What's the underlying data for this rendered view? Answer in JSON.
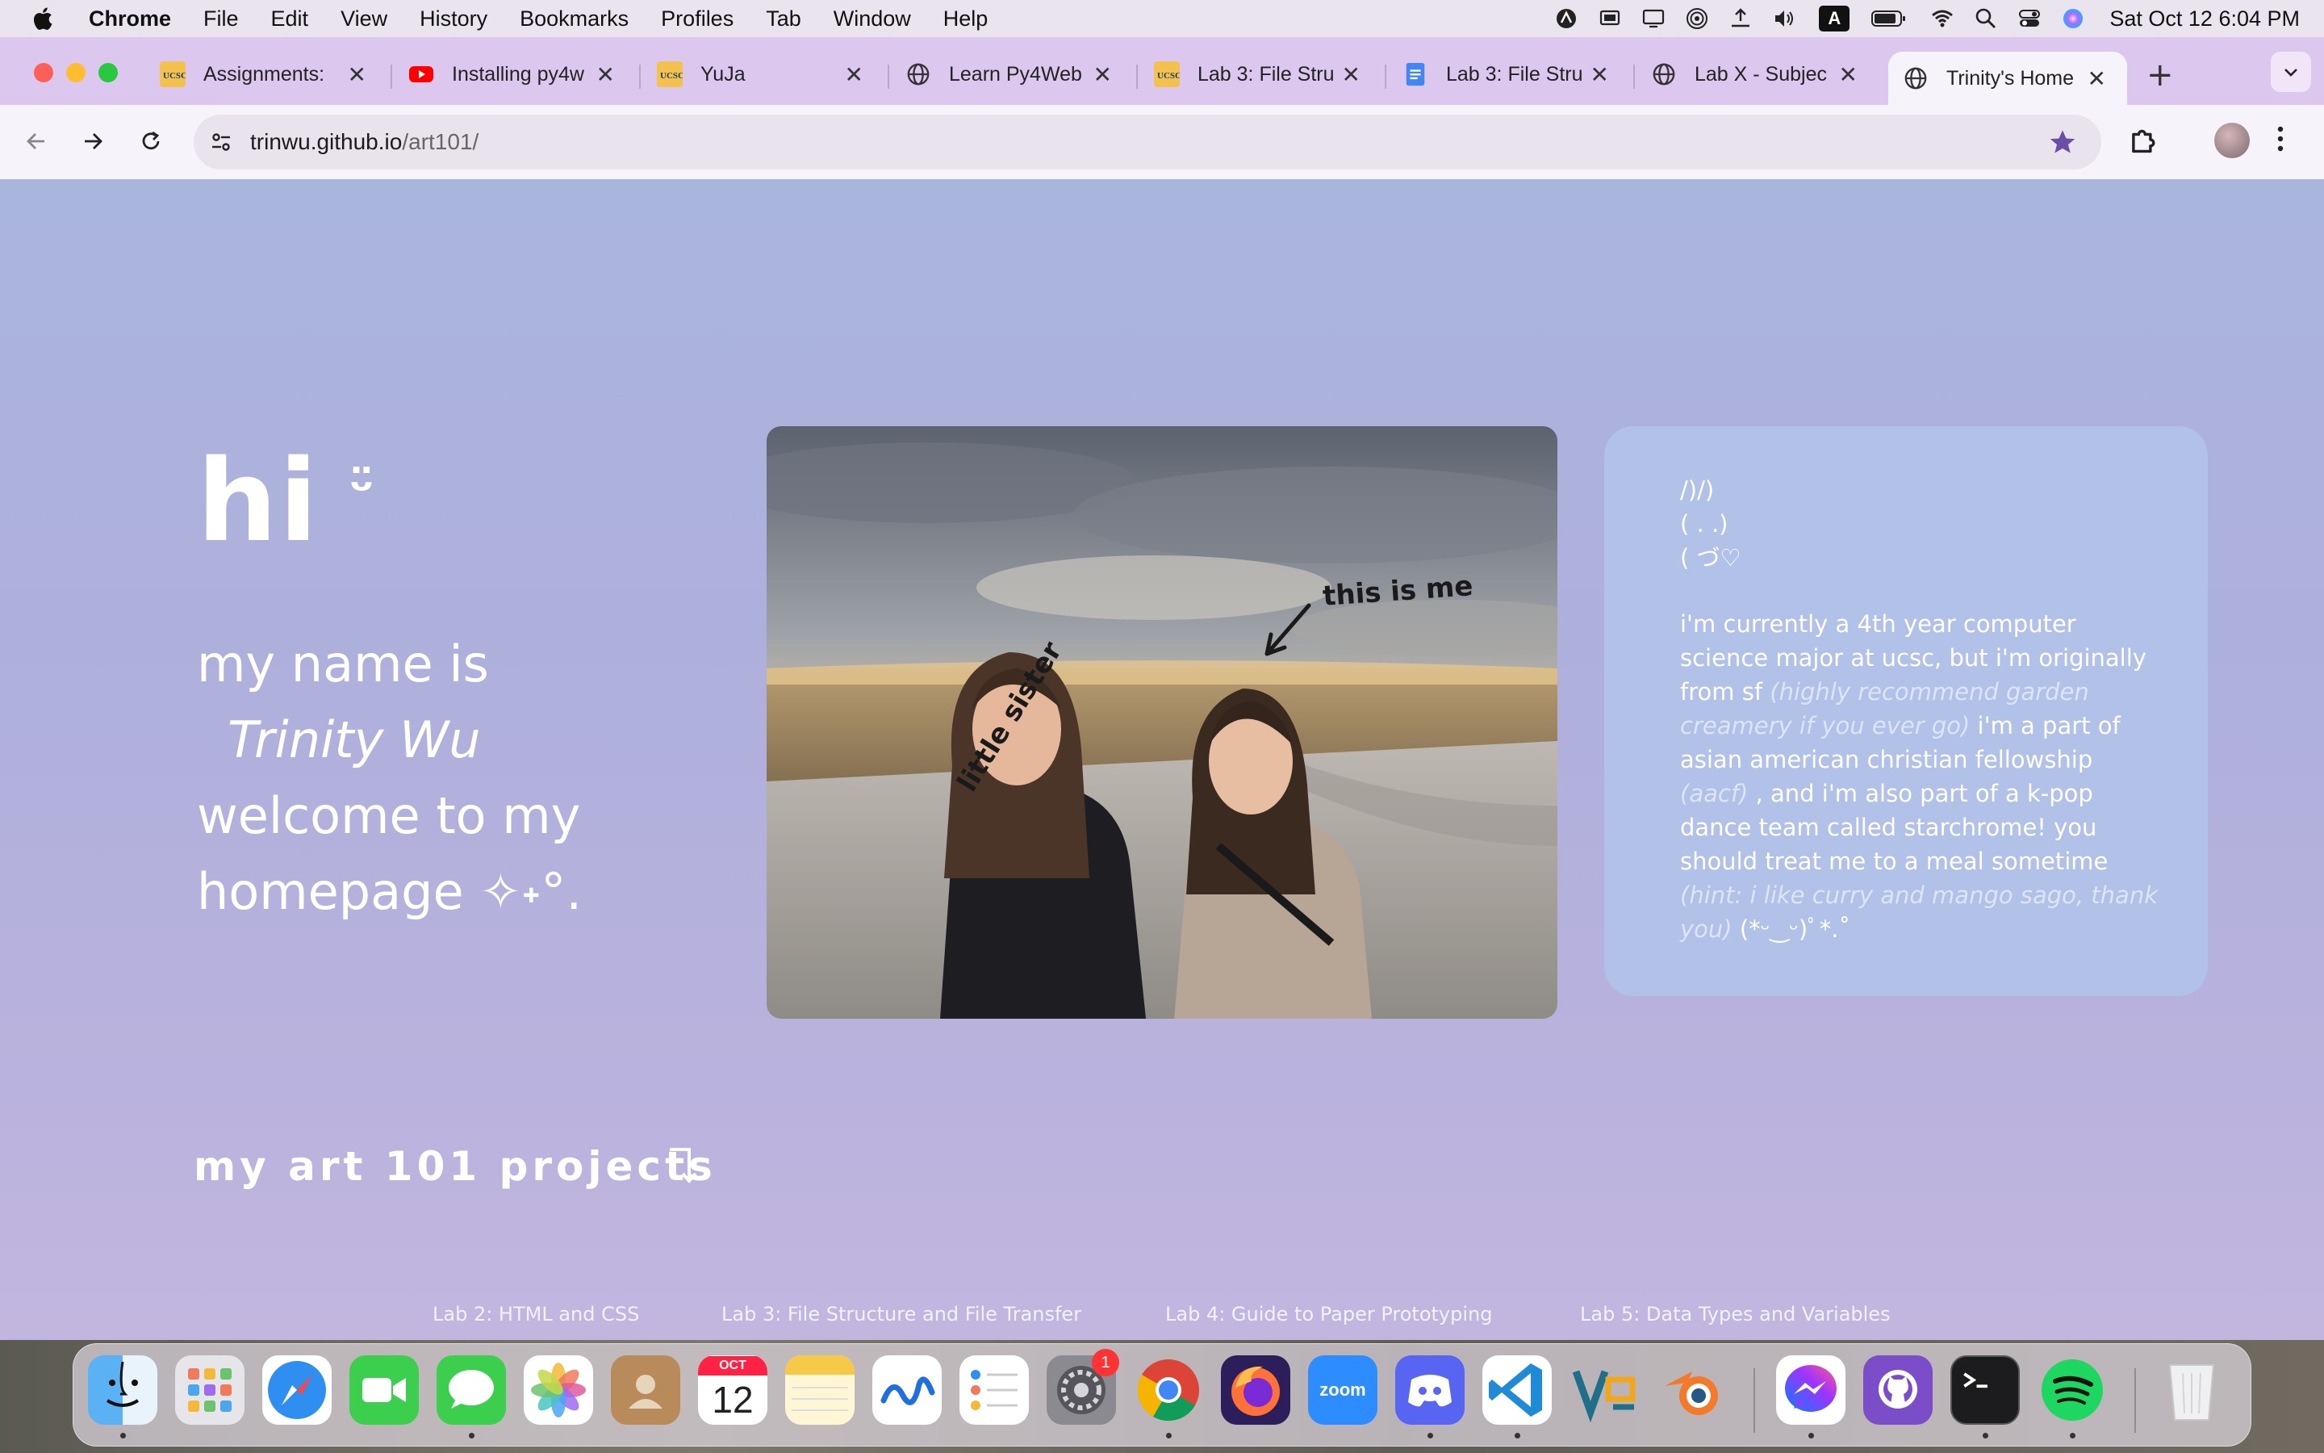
{
  "menubar": {
    "app_name": "Chrome",
    "items": [
      "File",
      "Edit",
      "View",
      "History",
      "Bookmarks",
      "Profiles",
      "Tab",
      "Window",
      "Help"
    ],
    "input_source": "A",
    "clock": "Sat Oct 12  6:04 PM"
  },
  "tabs": [
    {
      "title": "Assignments: ",
      "favicon": "ucsc-icon"
    },
    {
      "title": "Installing py4w",
      "favicon": "youtube-icon"
    },
    {
      "title": "YuJa",
      "favicon": "ucsc-icon"
    },
    {
      "title": "Learn Py4Web",
      "favicon": "globe-icon"
    },
    {
      "title": "Lab 3: File Stru",
      "favicon": "ucsc-icon"
    },
    {
      "title": "Lab 3: File Stru",
      "favicon": "google-docs-icon"
    },
    {
      "title": "Lab X - Subjec",
      "favicon": "globe-icon"
    },
    {
      "title": "Trinity's Home",
      "favicon": "globe-icon",
      "active": true
    }
  ],
  "toolbar": {
    "url_host": "trinwu.github.io",
    "url_path": "/art101/"
  },
  "page": {
    "hi": "hi",
    "smile": "ᵕ̈",
    "line1": "my name is",
    "name": "Trinity Wu",
    "line3": "welcome to my",
    "line4": "homepage ✧˖°.",
    "photo_label_sister": "little sister",
    "photo_label_me": "this is me",
    "bio": {
      "kaomoji": [
        "/)/)",
        "( . .)",
        "( づ♡"
      ],
      "p1": "i'm currently a 4th year computer science major at ucsc, but i'm originally from sf ",
      "p1_soft": "(highly recommend garden creamery if you ever go) ",
      "p2": " i'm a part of asian american christian fellowship ",
      "p2_soft": "(aacf) ",
      "p3": ", and i'm also part of a k-pop dance team called starchrome! you should treat me to a meal sometime ",
      "p3_soft": "(hint: i like curry and mango sago, thank you) ",
      "p4": " (*ᵕ‿ᵕ)ﾟ*.˚"
    },
    "projects_heading": "my art 101 projects",
    "project_links": [
      "Lab 2: HTML and CSS",
      "Lab 3: File Structure and File Transfer",
      "Lab 4: Guide to Paper Prototyping",
      "Lab 5: Data Types and Variables"
    ]
  },
  "dock": {
    "calendar_month": "OCT",
    "calendar_day": "12",
    "settings_badge": "1",
    "zoom_label": "zoom",
    "apps": [
      "Finder",
      "Launchpad",
      "Safari",
      "FaceTime",
      "Messages",
      "Photos",
      "Contacts",
      "Calendar",
      "Notes",
      "Freeform",
      "Reminders",
      "System Settings",
      "Chrome",
      "Firefox",
      "Zoom",
      "Discord",
      "VS Code",
      "Blender",
      "Messenger",
      "GitHub Desktop",
      "Terminal",
      "Spotify",
      "Trash"
    ]
  },
  "colors": {
    "page_top": "#a9b5dd",
    "page_bottom": "#c2b6df",
    "card_bg": "#b1c1e8",
    "tabstrip": "#dcc8ee",
    "toolbar": "#f7f3fb",
    "bookmark_star": "#6b4fa6"
  }
}
